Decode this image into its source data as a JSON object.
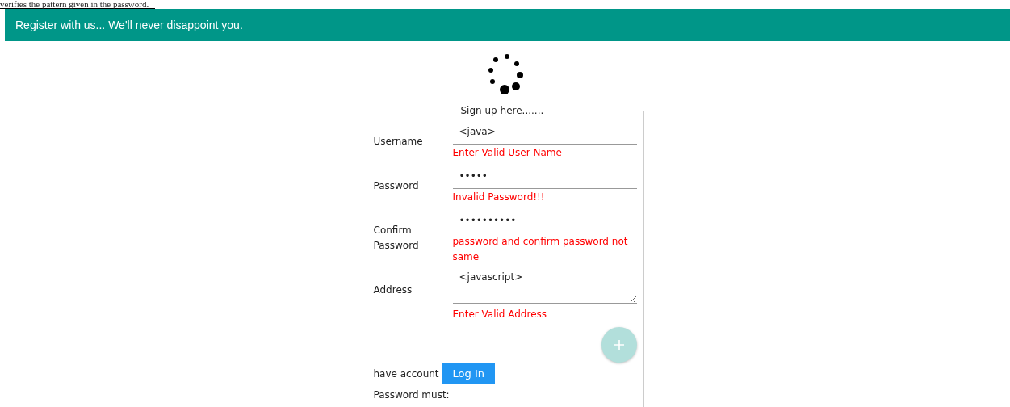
{
  "page_text": "verifies the pattern given in the password.",
  "header": {
    "title": "Register with us... We'll never disappoint you."
  },
  "form": {
    "legend": "Sign up here.......",
    "fields": [
      {
        "kind": "input",
        "label": "Username",
        "value": "<java>",
        "error": "Enter Valid User Name"
      },
      {
        "kind": "input",
        "label": "Password",
        "value": "•••••",
        "error": "Invalid Password!!!"
      },
      {
        "kind": "input",
        "label": "Confirm Password",
        "value": "••••••••••",
        "error": "password and confirm password not same"
      },
      {
        "kind": "textarea",
        "label": "Address",
        "value": "<javascript>",
        "error": "Enter Valid Address"
      }
    ],
    "have_account": "have account",
    "login_button": "Log In",
    "password_must": "Password must:"
  }
}
